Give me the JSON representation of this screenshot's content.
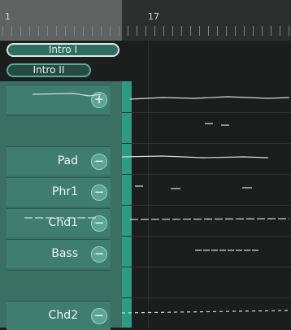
{
  "ruler": {
    "markers": [
      {
        "label": "1"
      },
      {
        "label": "17"
      }
    ]
  },
  "sections": [
    {
      "label": "Intro I",
      "selected": true
    },
    {
      "label": "Intro II",
      "selected": false
    }
  ],
  "tracks": [
    {
      "label": ""
    },
    {
      "label": ""
    },
    {
      "label": "Pad"
    },
    {
      "label": "Phr1"
    },
    {
      "label": "Chd1"
    },
    {
      "label": "Bass"
    },
    {
      "label": ""
    },
    {
      "label": "Chd2"
    }
  ],
  "icons": {
    "add": "plus-icon",
    "remove": "minus-icon"
  },
  "colors": {
    "panel": "#3c6f63",
    "accent": "#2f9a84",
    "background": "#1c1e1d"
  }
}
